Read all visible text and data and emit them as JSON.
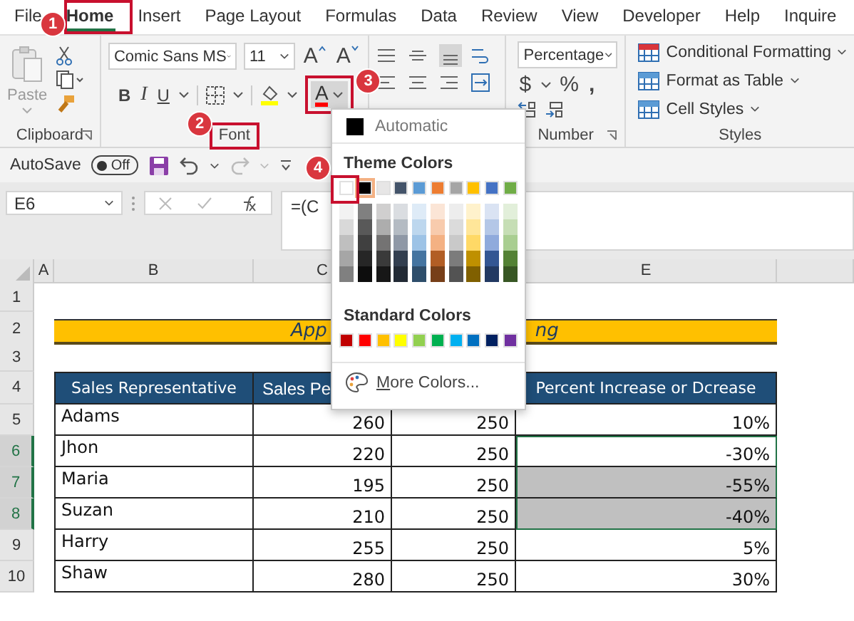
{
  "menu_tabs": [
    {
      "label": "File",
      "selected": false
    },
    {
      "label": "Home",
      "selected": true
    },
    {
      "label": "Insert",
      "selected": false
    },
    {
      "label": "Page Layout",
      "selected": false
    },
    {
      "label": "Formulas",
      "selected": false
    },
    {
      "label": "Data",
      "selected": false
    },
    {
      "label": "Review",
      "selected": false
    },
    {
      "label": "View",
      "selected": false
    },
    {
      "label": "Developer",
      "selected": false
    },
    {
      "label": "Help",
      "selected": false
    },
    {
      "label": "Inquire",
      "selected": false
    }
  ],
  "ribbon": {
    "clipboard": {
      "paste": "Paste",
      "label": "Clipboard"
    },
    "font": {
      "font_name": "Comic Sans MS",
      "font_size": "11",
      "grow": "A",
      "shrink": "A",
      "bold": "B",
      "italic": "I",
      "underline": "U",
      "font_color": "A",
      "label": "Font"
    },
    "number": {
      "format": "Percentage",
      "currency": "$",
      "percent": "%",
      "comma": ",",
      "label": "Number"
    },
    "styles": {
      "items": [
        "Conditional Formatting",
        "Format as Table",
        "Cell Styles"
      ],
      "label": "Styles"
    }
  },
  "quick_access": {
    "autosave": "AutoSave",
    "toggle": "Off",
    "on": false
  },
  "formula_bar": {
    "name_box": "E6",
    "formula": "=(C"
  },
  "columns": [
    {
      "letter": "A"
    },
    {
      "letter": "B"
    },
    {
      "letter": "C"
    },
    {
      "letter": "E"
    }
  ],
  "row_numbers": [
    {
      "label": "1",
      "selected": false
    },
    {
      "label": "2",
      "selected": false
    },
    {
      "label": "3",
      "selected": false
    },
    {
      "label": "4",
      "selected": false
    },
    {
      "label": "5",
      "selected": false
    },
    {
      "label": "6",
      "selected": true
    },
    {
      "label": "7",
      "selected": true
    },
    {
      "label": "8",
      "selected": true
    },
    {
      "label": "9",
      "selected": false
    },
    {
      "label": "10",
      "selected": false
    }
  ],
  "banner": {
    "left_text": "App",
    "right_text": "ng"
  },
  "table": {
    "headers": [
      "Sales Representative",
      "Sales Pe",
      "Percent Increase or Dcrease"
    ],
    "rows": [
      {
        "name": "Adams",
        "sales": "260",
        "target": "250",
        "change": "10%",
        "shaded": false,
        "selected": false
      },
      {
        "name": "Jhon",
        "sales": "220",
        "target": "250",
        "change": "-30%",
        "shaded": false,
        "selected": true
      },
      {
        "name": "Maria",
        "sales": "195",
        "target": "250",
        "change": "-55%",
        "shaded": true,
        "selected": true
      },
      {
        "name": "Suzan",
        "sales": "210",
        "target": "250",
        "change": "-40%",
        "shaded": true,
        "selected": true
      },
      {
        "name": "Harry",
        "sales": "255",
        "target": "250",
        "change": "5%",
        "shaded": false,
        "selected": false
      },
      {
        "name": "Shaw",
        "sales": "280",
        "target": "250",
        "change": "30%",
        "shaded": false,
        "selected": false
      }
    ]
  },
  "color_menu": {
    "automatic": "Automatic",
    "theme_title": "Theme Colors",
    "theme_colors": [
      {
        "color": "#ffffff",
        "selected": false
      },
      {
        "color": "#000000",
        "selected": true
      },
      {
        "color": "#e7e6e6",
        "selected": false
      },
      {
        "color": "#44546a",
        "selected": false
      },
      {
        "color": "#5b9bd5",
        "selected": false
      },
      {
        "color": "#ed7d31",
        "selected": false
      },
      {
        "color": "#a5a5a5",
        "selected": false
      },
      {
        "color": "#ffc000",
        "selected": false
      },
      {
        "color": "#4472c4",
        "selected": false
      },
      {
        "color": "#70ad47",
        "selected": false
      }
    ],
    "standard_title": "Standard Colors",
    "standard_colors": [
      {
        "color": "#c00000"
      },
      {
        "color": "#ff0000"
      },
      {
        "color": "#ffc000"
      },
      {
        "color": "#ffff00"
      },
      {
        "color": "#92d050"
      },
      {
        "color": "#00b050"
      },
      {
        "color": "#00b0f0"
      },
      {
        "color": "#0070c0"
      },
      {
        "color": "#002060"
      },
      {
        "color": "#7030a0"
      }
    ],
    "more": "More Colors..."
  },
  "annotations": [
    {
      "number": "1"
    },
    {
      "number": "2"
    },
    {
      "number": "3"
    },
    {
      "number": "4"
    }
  ]
}
